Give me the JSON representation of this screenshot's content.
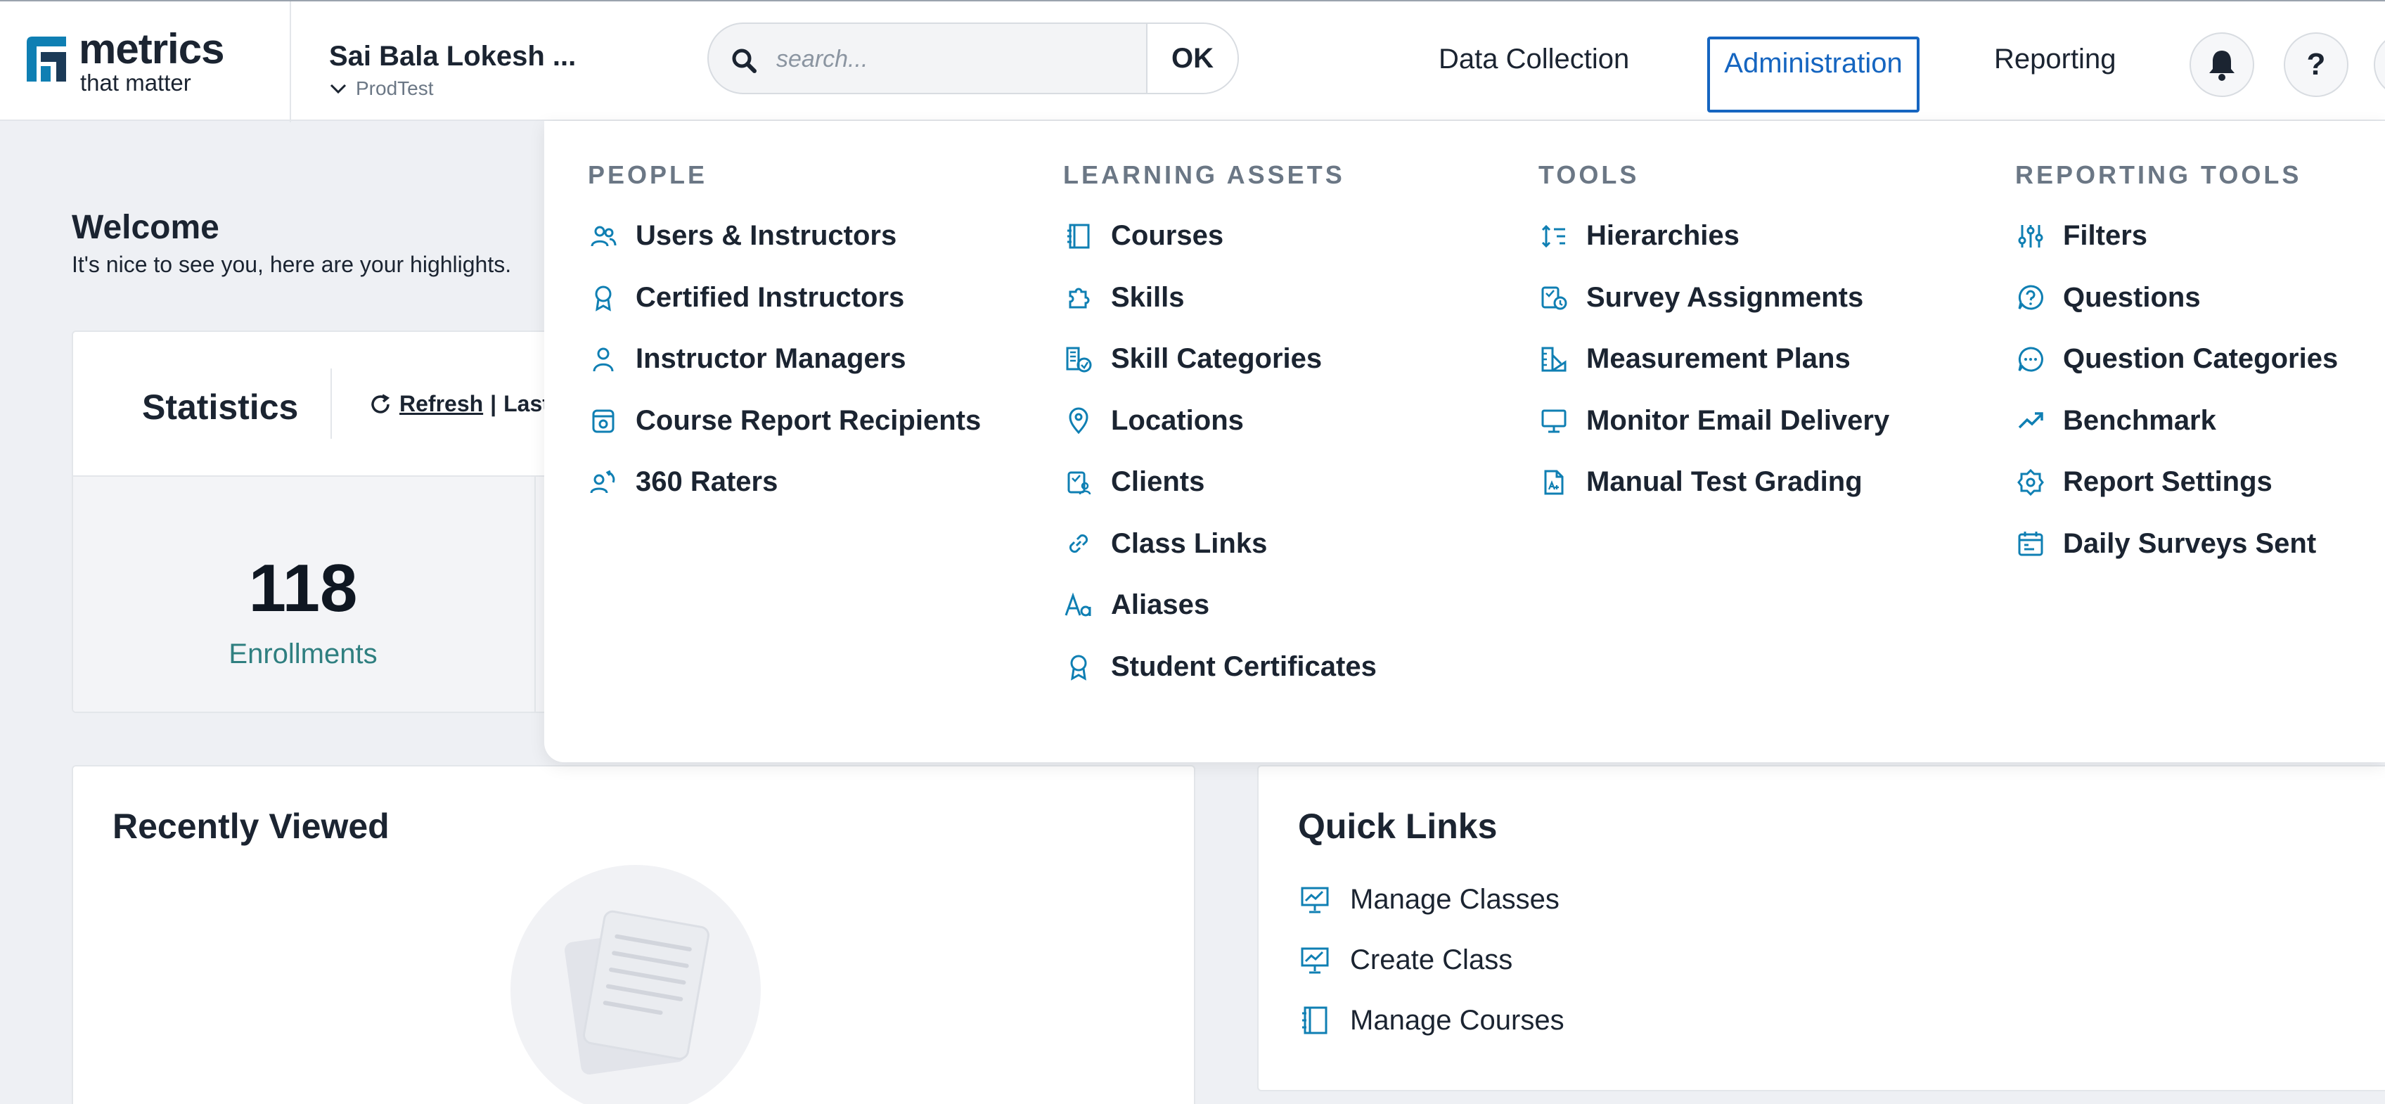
{
  "brand": {
    "name": "metrics",
    "tagline": "that matter",
    "accent": "#0f7fb3",
    "accent_dark": "#1b2431"
  },
  "user": {
    "name": "Sai Bala Lokesh ...",
    "org": "ProdTest"
  },
  "search": {
    "placeholder": "search...",
    "value": "",
    "ok_label": "OK"
  },
  "nav": {
    "data_collection": "Data Collection",
    "administration": "Administration",
    "reporting": "Reporting",
    "help_label": "?",
    "active": "Administration",
    "active_color": "#1565c0"
  },
  "mega_menu": {
    "columns": [
      {
        "title": "PEOPLE",
        "items": [
          {
            "label": "Users & Instructors",
            "icon": "users-icon"
          },
          {
            "label": "Certified Instructors",
            "icon": "award-icon"
          },
          {
            "label": "Instructor Managers",
            "icon": "user-icon"
          },
          {
            "label": "Course Report Recipients",
            "icon": "report-icon"
          },
          {
            "label": "360 Raters",
            "icon": "raters-icon"
          }
        ]
      },
      {
        "title": "LEARNING ASSETS",
        "items": [
          {
            "label": "Courses",
            "icon": "book-icon"
          },
          {
            "label": "Skills",
            "icon": "puzzle-icon"
          },
          {
            "label": "Skill Categories",
            "icon": "skill-categories-icon"
          },
          {
            "label": "Locations",
            "icon": "map-pin-icon"
          },
          {
            "label": "Clients",
            "icon": "clients-icon"
          },
          {
            "label": "Class Links",
            "icon": "link-icon"
          },
          {
            "label": "Aliases",
            "icon": "aliases-icon"
          },
          {
            "label": "Student Certificates",
            "icon": "certificate-icon"
          }
        ]
      },
      {
        "title": "TOOLS",
        "items": [
          {
            "label": "Hierarchies",
            "icon": "hierarchy-icon"
          },
          {
            "label": "Survey Assignments",
            "icon": "survey-assignment-icon"
          },
          {
            "label": "Measurement Plans",
            "icon": "measurement-icon"
          },
          {
            "label": "Monitor Email Delivery",
            "icon": "monitor-icon"
          },
          {
            "label": "Manual Test Grading",
            "icon": "document-icon"
          }
        ]
      },
      {
        "title": "REPORTING TOOLS",
        "items": [
          {
            "label": "Filters",
            "icon": "sliders-icon"
          },
          {
            "label": "Questions",
            "icon": "question-icon"
          },
          {
            "label": "Question Categories",
            "icon": "chat-icon"
          },
          {
            "label": "Benchmark",
            "icon": "trend-icon"
          },
          {
            "label": "Report Settings",
            "icon": "settings-icon"
          },
          {
            "label": "Daily Surveys Sent",
            "icon": "calendar-icon"
          }
        ]
      }
    ]
  },
  "welcome": {
    "title": "Welcome",
    "subtitle": "It's nice to see you, here are your highlights."
  },
  "statistics": {
    "title": "Statistics",
    "refresh_label": "Refresh",
    "separator": "|",
    "period_label": "Last",
    "stats": [
      {
        "value": "118",
        "label": "Enrollments"
      }
    ]
  },
  "recently_viewed": {
    "title": "Recently Viewed"
  },
  "quick_links": {
    "title": "Quick Links",
    "items": [
      {
        "label": "Manage Classes",
        "icon": "presentation-icon"
      },
      {
        "label": "Create Class",
        "icon": "presentation-icon"
      },
      {
        "label": "Manage Courses",
        "icon": "book-icon"
      }
    ]
  }
}
